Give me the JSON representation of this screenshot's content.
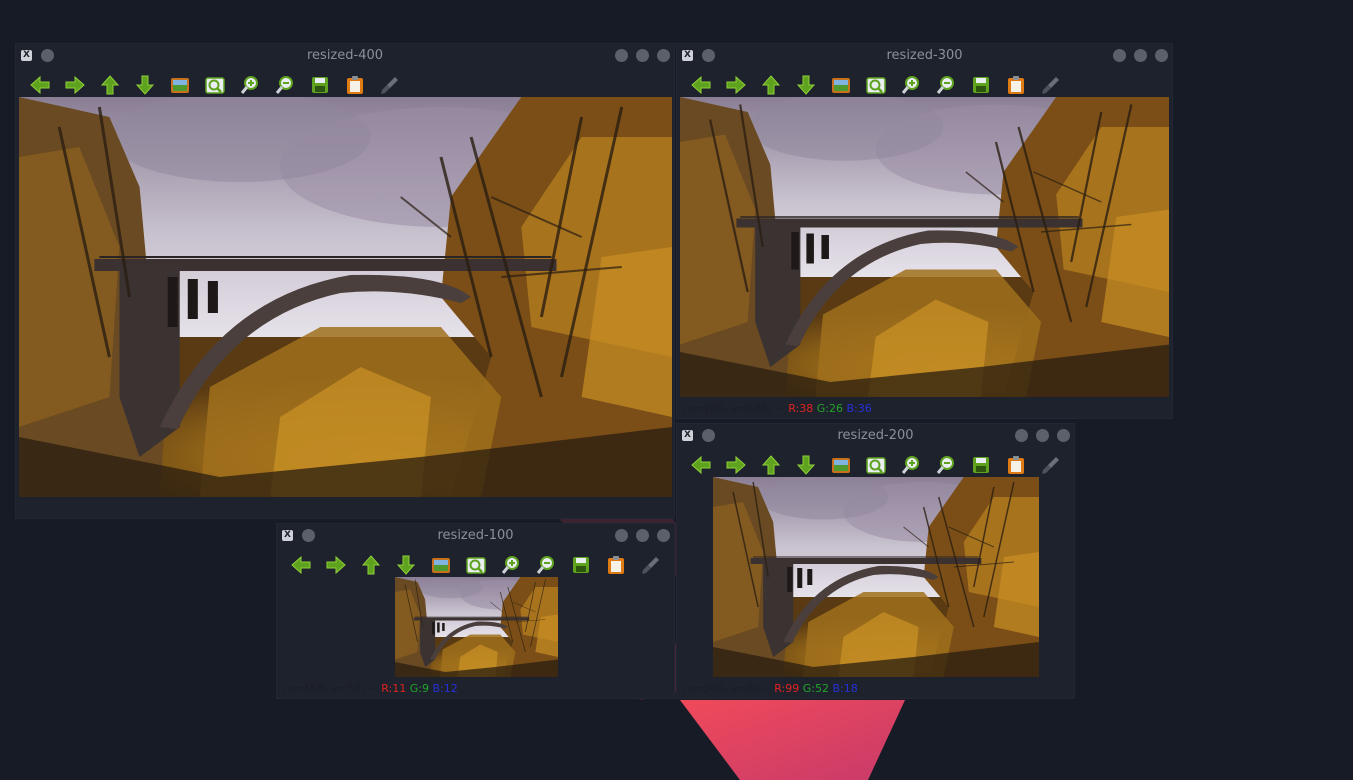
{
  "windows": [
    {
      "id": "resized-400",
      "title": "resized-400",
      "status": null
    },
    {
      "id": "resized-300",
      "title": "resized-300",
      "status": {
        "coords": "(x=125, y=185) ~",
        "r": "R:38",
        "g": "G:26",
        "b": "B:36"
      }
    },
    {
      "id": "resized-200",
      "title": "resized-200",
      "status": {
        "coords": "(x=306, y=8) ~",
        "r": "R:99",
        "g": "G:52",
        "b": "B:18"
      }
    },
    {
      "id": "resized-100",
      "title": "resized-100",
      "status": {
        "coords": "(x=158, y=58) ~",
        "r": "R:11",
        "g": "G:9",
        "b": "B:12"
      }
    }
  ],
  "toolbar": {
    "buttons": [
      {
        "name": "pan-left-button",
        "icon": "arrow-left-icon"
      },
      {
        "name": "pan-right-button",
        "icon": "arrow-right-icon"
      },
      {
        "name": "pan-up-button",
        "icon": "arrow-up-icon"
      },
      {
        "name": "pan-down-button",
        "icon": "arrow-down-icon"
      },
      {
        "name": "zoom-fit-button",
        "icon": "image-icon"
      },
      {
        "name": "zoom-region-button",
        "icon": "zoom-region-icon"
      },
      {
        "name": "zoom-in-button",
        "icon": "zoom-in-icon"
      },
      {
        "name": "zoom-out-button",
        "icon": "zoom-out-icon"
      },
      {
        "name": "save-button",
        "icon": "save-icon"
      },
      {
        "name": "copy-button",
        "icon": "clipboard-icon"
      },
      {
        "name": "properties-button",
        "icon": "brush-icon"
      }
    ]
  },
  "colors": {
    "desktop": "#171b26",
    "window": "#1e222c",
    "accent_pink": "#e9435f",
    "icon_green": "#5fa21e"
  }
}
